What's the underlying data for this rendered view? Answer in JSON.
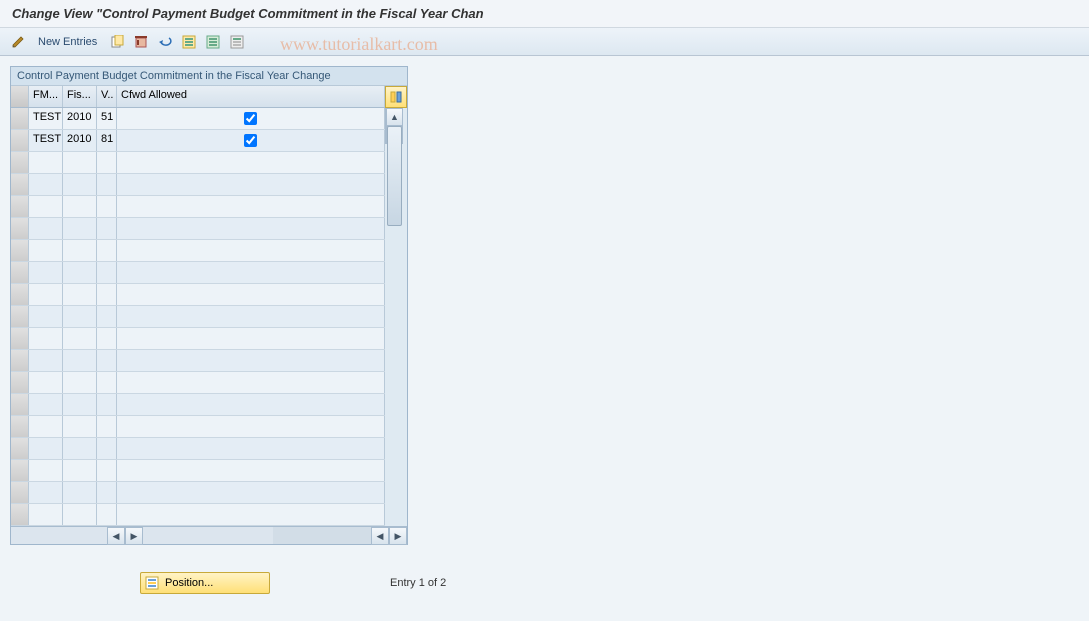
{
  "title": "Change View \"Control Payment Budget Commitment in the Fiscal Year Chan",
  "watermark": "www.tutorialkart.com",
  "toolbar": {
    "new_entries_label": "New Entries"
  },
  "panel": {
    "title": "Control Payment Budget Commitment in the Fiscal Year Change",
    "columns": {
      "fm": "FM...",
      "fis": "Fis...",
      "v": "V..",
      "cfwd": "Cfwd Allowed"
    },
    "rows": [
      {
        "fm": "TEST",
        "fis": "2010",
        "v": "51",
        "cfwd": true
      },
      {
        "fm": "TEST",
        "fis": "2010",
        "v": "81",
        "cfwd": true
      }
    ],
    "empty_row_count": 17
  },
  "footer": {
    "position_label": "Position...",
    "entry_text": "Entry 1 of 2"
  }
}
